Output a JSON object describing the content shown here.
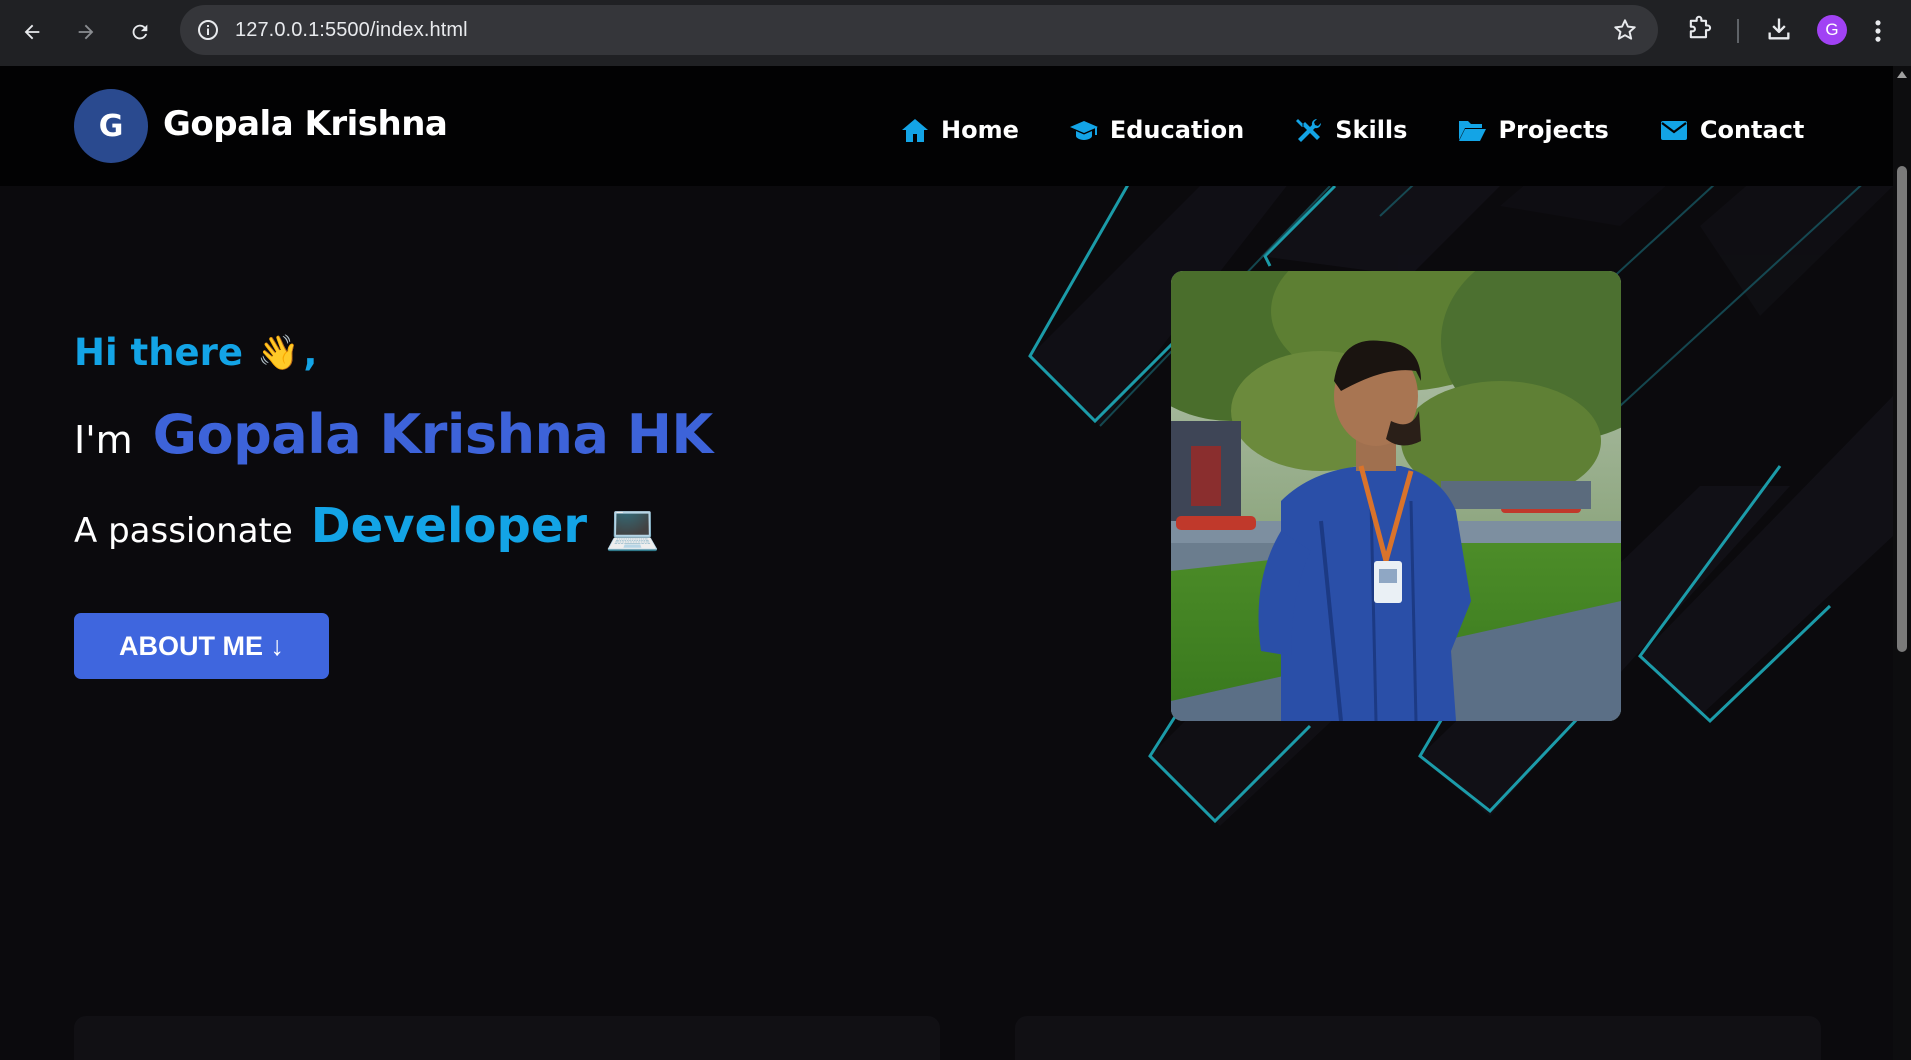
{
  "browser": {
    "url": "127.0.0.1:5500/index.html",
    "profile_initial": "G"
  },
  "header": {
    "logo_letter": "G",
    "brand": "Gopala Krishna"
  },
  "nav": {
    "items": [
      {
        "label": "Home",
        "icon": "home-icon"
      },
      {
        "label": "Education",
        "icon": "graduation-cap-icon"
      },
      {
        "label": "Skills",
        "icon": "tools-icon"
      },
      {
        "label": "Projects",
        "icon": "folder-open-icon"
      },
      {
        "label": "Contact",
        "icon": "envelope-icon"
      }
    ]
  },
  "hero": {
    "greeting": "Hi there",
    "wave_emoji": "👋",
    "greeting_comma": ",",
    "im": "I'm",
    "name": "Gopala Krishna HK",
    "passionate": "A passionate",
    "role": "Developer",
    "laptop_emoji": "💻",
    "about_button": "ABOUT ME ↓"
  },
  "colors": {
    "accent_cyan": "#13a4e6",
    "accent_blue": "#3d63d9",
    "button_blue": "#3f66de",
    "background": "#0b0a0d"
  }
}
